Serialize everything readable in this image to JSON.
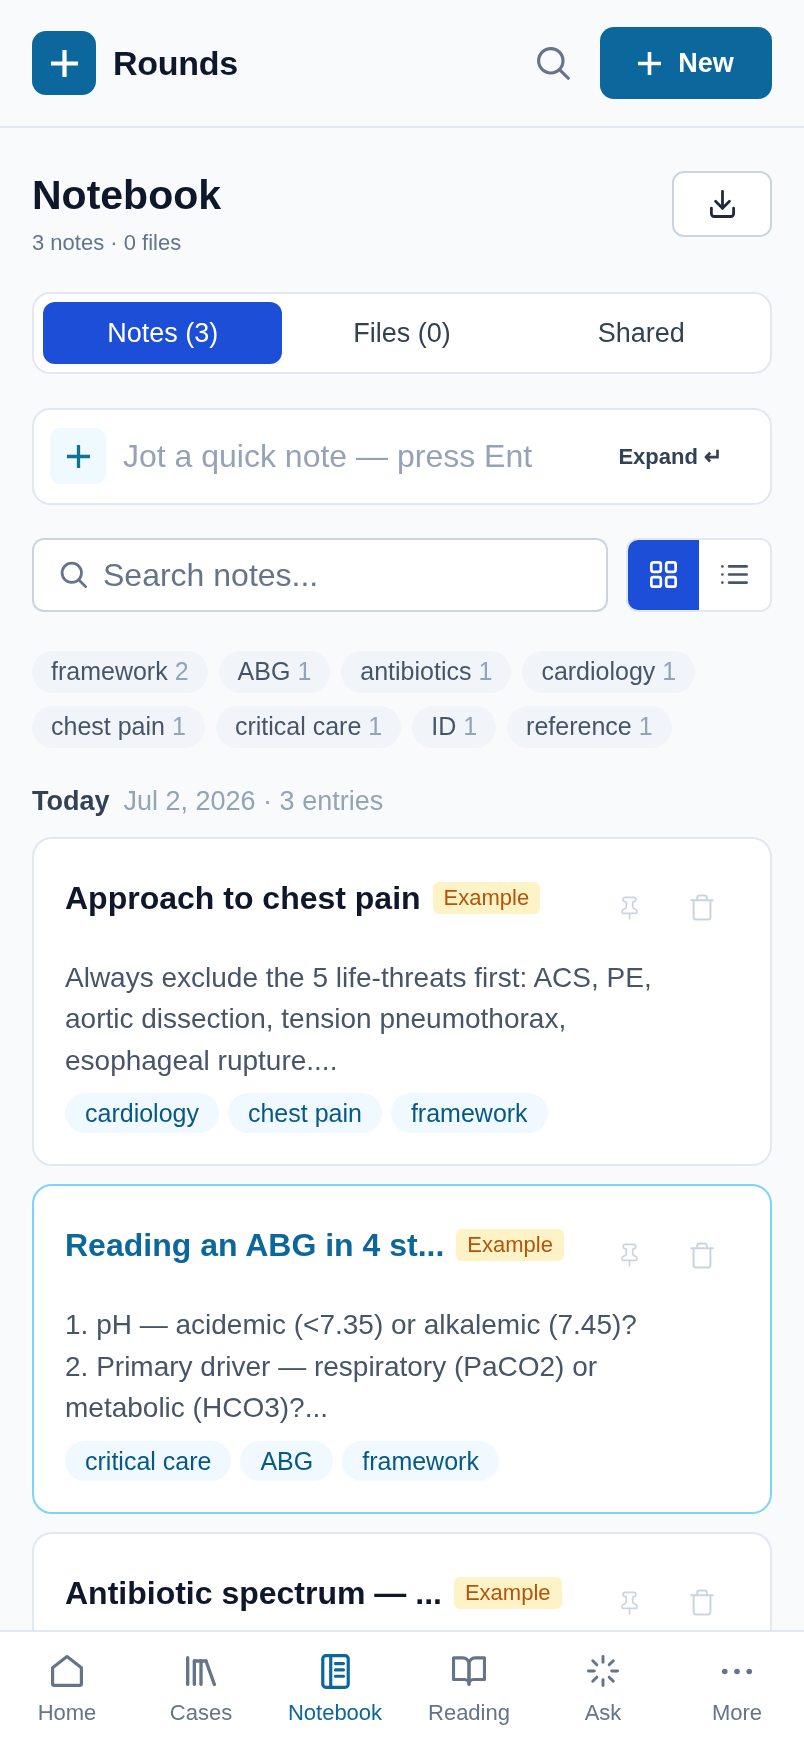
{
  "app_bar": {
    "title": "Rounds",
    "new_button": "New"
  },
  "header": {
    "title": "Notebook",
    "subtitle": "3 notes · 0 files"
  },
  "tabs": [
    {
      "label": "Notes (3)",
      "selected": true
    },
    {
      "label": "Files (0)",
      "selected": false
    },
    {
      "label": "Shared",
      "selected": false
    }
  ],
  "quick_note": {
    "placeholder": "Jot a quick note — press Ent",
    "expand_button": "Expand ↵"
  },
  "search": {
    "placeholder": "Search notes..."
  },
  "view_toggle": [
    {
      "kind": "grid",
      "selected": true
    },
    {
      "kind": "list",
      "selected": false
    }
  ],
  "tag_filters": [
    {
      "label": "framework",
      "count": "2"
    },
    {
      "label": "ABG",
      "count": "1"
    },
    {
      "label": "antibiotics",
      "count": "1"
    },
    {
      "label": "cardiology",
      "count": "1"
    },
    {
      "label": "chest pain",
      "count": "1"
    },
    {
      "label": "critical care",
      "count": "1"
    },
    {
      "label": "ID",
      "count": "1"
    },
    {
      "label": "reference",
      "count": "1"
    }
  ],
  "date_group": {
    "label": "Today",
    "meta": "Jul 2, 2026 · 3 entries"
  },
  "notes": [
    {
      "title": "Approach to chest pain",
      "badge": "Example",
      "selected": false,
      "body": "Always exclude the 5 life-threats first: ACS, PE, aortic dissection, tension pneumothorax, esophageal rupture....",
      "tags": [
        "cardiology",
        "chest pain",
        "framework"
      ]
    },
    {
      "title": "Reading an ABG in 4 st...",
      "badge": "Example",
      "selected": true,
      "body": "1. pH — acidemic (<7.35) or alkalemic (7.45)?\n2. Primary driver — respiratory (PaCO2) or metabolic (HCO3)?...",
      "tags": [
        "critical care",
        "ABG",
        "framework"
      ]
    },
    {
      "title": "Antibiotic spectrum — ...",
      "badge": "Example",
      "selected": false
    }
  ],
  "bottom_nav": [
    {
      "kind": "home",
      "label": "Home",
      "selected": false
    },
    {
      "kind": "library",
      "label": "Cases",
      "selected": false
    },
    {
      "kind": "notebook",
      "label": "Notebook",
      "selected": true
    },
    {
      "kind": "book",
      "label": "Reading",
      "selected": false
    },
    {
      "kind": "rays",
      "label": "Ask",
      "selected": false
    },
    {
      "kind": "more",
      "label": "More",
      "selected": false
    }
  ]
}
